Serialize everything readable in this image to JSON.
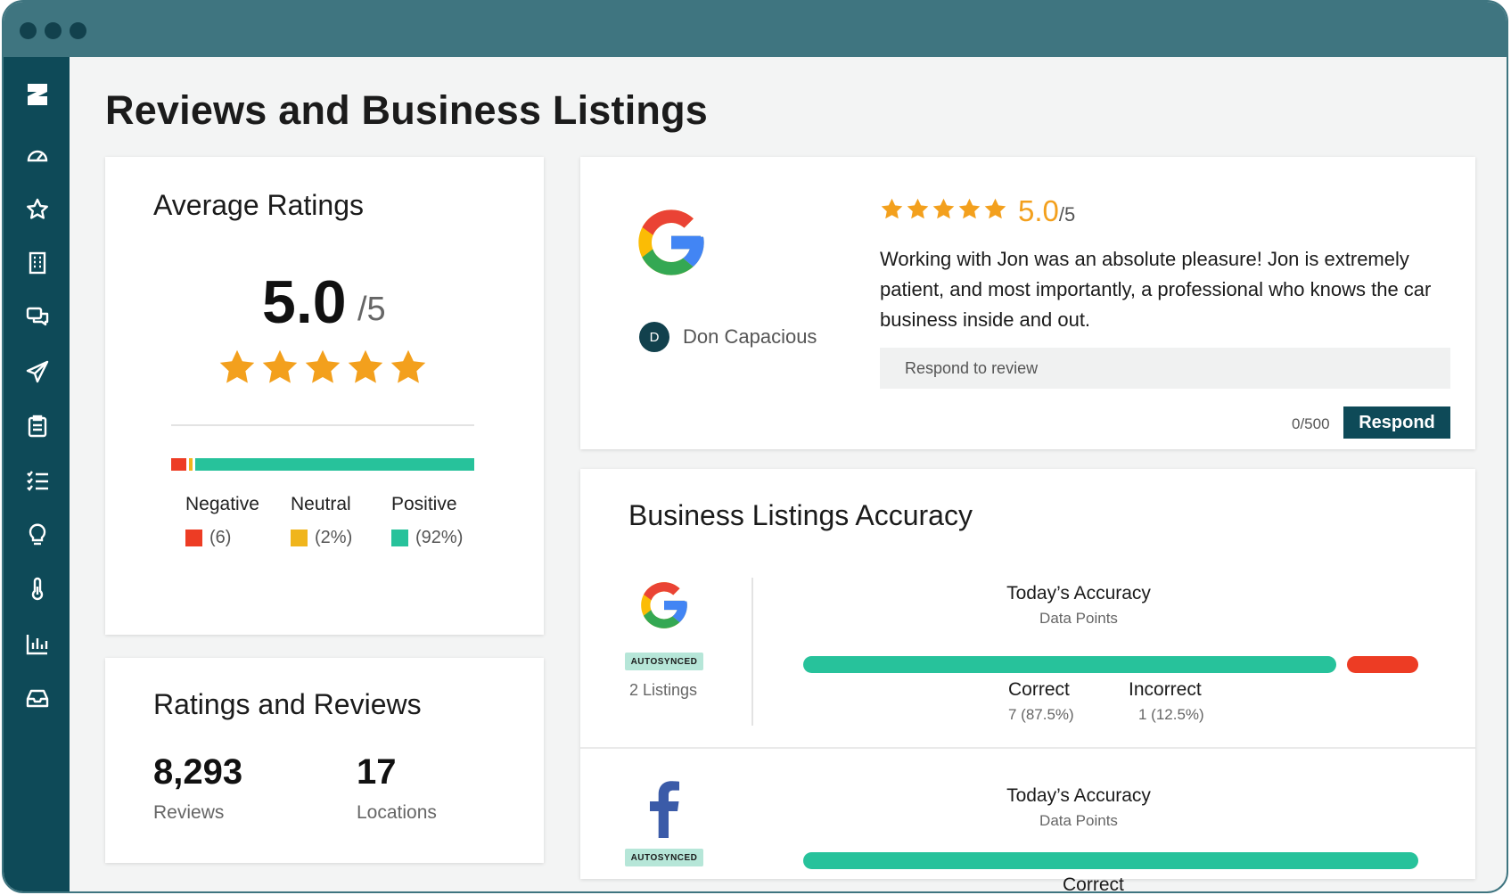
{
  "page": {
    "title": "Reviews and Business Listings"
  },
  "colors": {
    "titlebar": "#3f7580",
    "sidebar": "#0e4a58",
    "star": "#f3a01d",
    "negative": "#ed3c24",
    "neutral": "#f0b51c",
    "positive": "#27c29b",
    "google_blue": "#4285f4",
    "google_red": "#ea4335",
    "google_yellow": "#fbbc05",
    "google_green": "#34a853",
    "facebook": "#3b5ba8"
  },
  "sidebar": {
    "icons": [
      "logo-icon",
      "dashboard-gauge-icon",
      "star-icon",
      "building-icon",
      "chat-icon",
      "send-icon",
      "clipboard-icon",
      "checklist-icon",
      "lightbulb-icon",
      "thermometer-icon",
      "bar-chart-icon",
      "inbox-icon"
    ]
  },
  "average_ratings": {
    "title": "Average Ratings",
    "score": "5.0",
    "denominator": "/5",
    "stars": 5,
    "sentiment": [
      {
        "label": "Negative",
        "value": "(6)",
        "fraction": 0.06,
        "color": "#ed3c24"
      },
      {
        "label": "Neutral",
        "value": "(2%)",
        "fraction": 0.02,
        "color": "#f0b51c"
      },
      {
        "label": "Positive",
        "value": "(92%)",
        "fraction": 0.92,
        "color": "#27c29b"
      }
    ]
  },
  "ratings_reviews": {
    "title": "Ratings and Reviews",
    "metrics": [
      {
        "number": "8,293",
        "label": "Reviews"
      },
      {
        "number": "17",
        "label": "Locations"
      }
    ]
  },
  "review": {
    "source_icon": "google-icon",
    "stars": 5,
    "score": "5.0",
    "denominator": "/5",
    "text": "Working with Jon was an absolute pleasure! Jon is extremely patient, and most importantly, a professional who knows the car business inside and out.",
    "reviewer_initial": "D",
    "reviewer_name": "Don Capacious",
    "respond_placeholder": "Respond to review",
    "char_count": "0/500",
    "respond_label": "Respond"
  },
  "accuracy": {
    "title": "Business Listings Accuracy",
    "listings": [
      {
        "source_icon": "google-icon",
        "badge": "AUTOSYNCED",
        "count": "2 Listings",
        "heading": "Today’s Accuracy",
        "subheading": "Data Points",
        "correct_fraction": 0.875,
        "correct_label": "Correct",
        "correct_value": "7 (87.5%)",
        "incorrect_label": "Incorrect",
        "incorrect_value": "1 (12.5%)"
      },
      {
        "source_icon": "facebook-icon",
        "badge": "AUTOSYNCED",
        "heading": "Today’s Accuracy",
        "subheading": "Data Points",
        "correct_fraction": 1.0,
        "correct_label": "Correct"
      }
    ]
  }
}
